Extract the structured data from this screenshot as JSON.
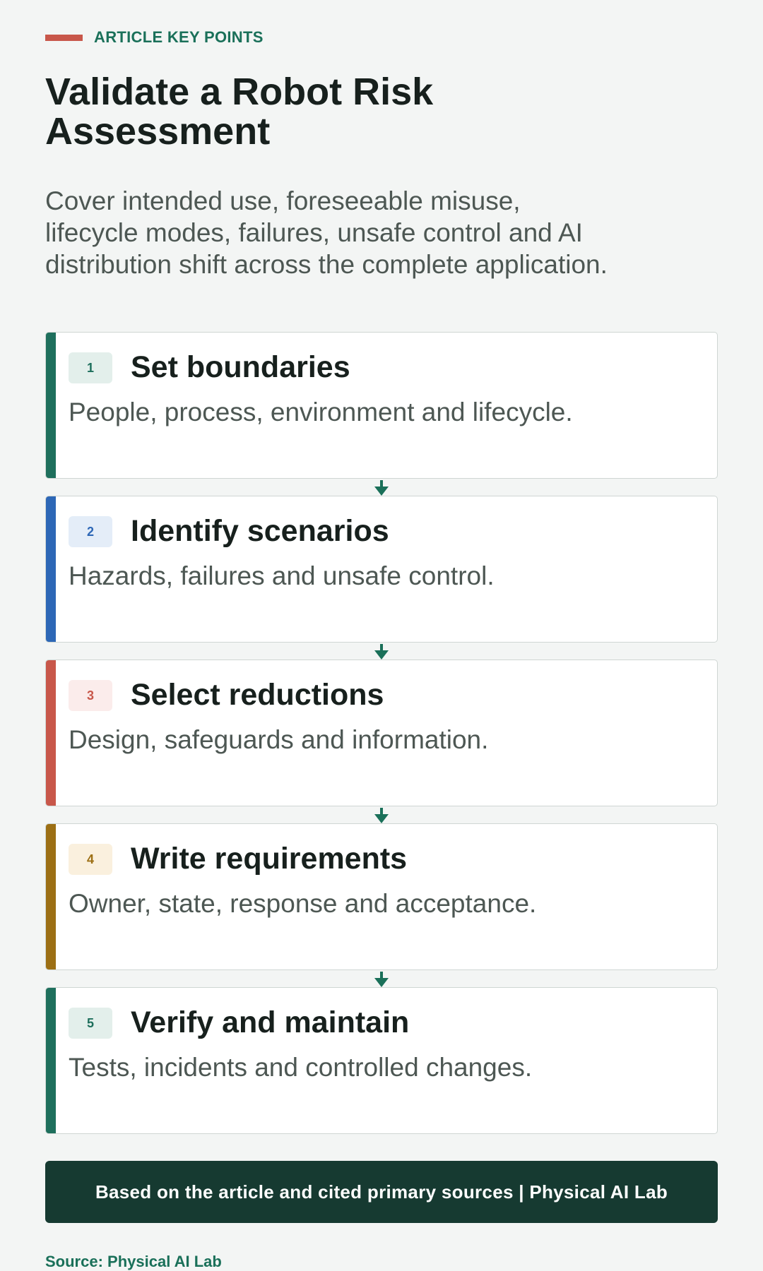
{
  "header": {
    "kicker": "ARTICLE KEY POINTS",
    "title": "Validate a Robot Risk Assessment",
    "subtitle": "Cover intended use, foreseeable misuse, lifecycle modes, failures, unsafe control and AI distribution shift across the complete application."
  },
  "steps": [
    {
      "number": "1",
      "title": "Set boundaries",
      "description": "People, process, environment and lifecycle.",
      "accent": "#1e6f5c",
      "badge_bg": "#e3efeb",
      "badge_fg": "#1e6f5c"
    },
    {
      "number": "2",
      "title": "Identify scenarios",
      "description": "Hazards, failures and unsafe control.",
      "accent": "#2d67b6",
      "badge_bg": "#e4edf8",
      "badge_fg": "#2d67b6"
    },
    {
      "number": "3",
      "title": "Select reductions",
      "description": "Design, safeguards and information.",
      "accent": "#c8574a",
      "badge_bg": "#fbeceb",
      "badge_fg": "#c8574a"
    },
    {
      "number": "4",
      "title": "Write requirements",
      "description": "Owner, state, response and acceptance.",
      "accent": "#9c6f14",
      "badge_bg": "#faf0de",
      "badge_fg": "#9c6f14"
    },
    {
      "number": "5",
      "title": "Verify and maintain",
      "description": "Tests, incidents and controlled changes.",
      "accent": "#1e6f5c",
      "badge_bg": "#e3efeb",
      "badge_fg": "#1e6f5c"
    }
  ],
  "arrow_icon": "arrow-down-icon",
  "arrow_color": "#1a7059",
  "footer": {
    "band_text": "Based on the article and cited primary sources | Physical AI Lab",
    "source": "Source: Physical AI Lab"
  }
}
